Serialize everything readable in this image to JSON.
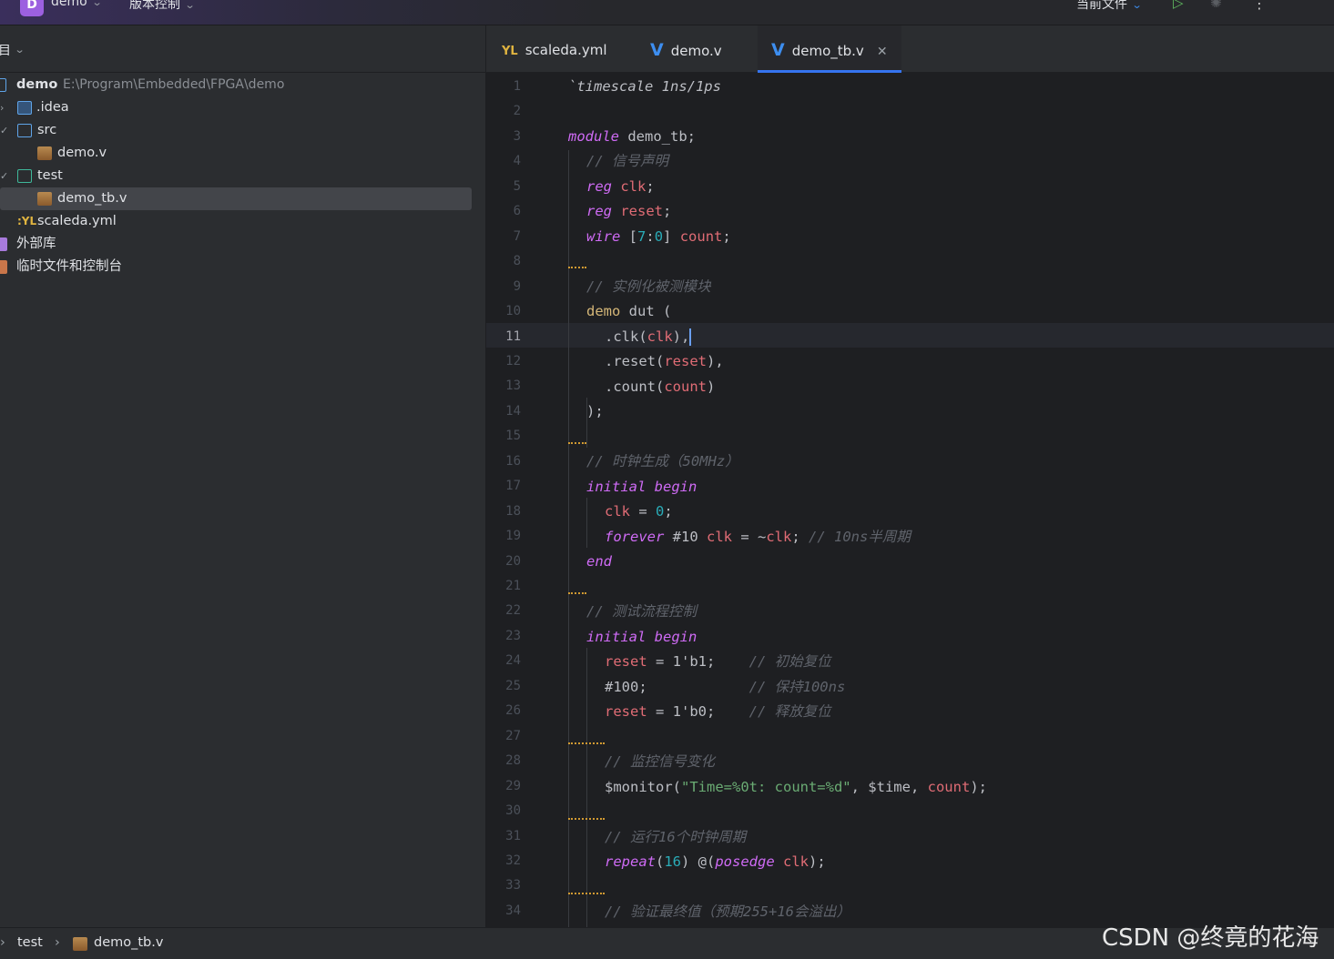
{
  "titlebar": {
    "project_badge": "D",
    "project_name": "demo",
    "vcs_label": "版本控制",
    "run_config": "当前文件",
    "icons": [
      "chevron-down-icon",
      "run-icon",
      "debug-icon",
      "more-icon"
    ]
  },
  "sidebar": {
    "title": "目",
    "root_name": "demo",
    "root_path": "E:\\Program\\Embedded\\FPGA\\demo",
    "items": [
      {
        "label": ".idea"
      },
      {
        "label": "src"
      },
      {
        "label": "demo.v"
      },
      {
        "label": "test"
      },
      {
        "label": "demo_tb.v"
      },
      {
        "label": "scaleda.yml"
      },
      {
        "label": "外部库"
      },
      {
        "label": "临时文件和控制台"
      }
    ]
  },
  "tabs": [
    {
      "label": "scaleda.yml",
      "icon": "yaml-file-icon",
      "active": false
    },
    {
      "label": "demo.v",
      "icon": "verilog-v-icon",
      "active": false
    },
    {
      "label": "demo_tb.v",
      "icon": "verilog-v-icon",
      "active": true
    }
  ],
  "editor": {
    "current_line": "11",
    "line_numbers": [
      "1",
      "2",
      "3",
      "4",
      "5",
      "6",
      "7",
      "8",
      "9",
      "10",
      "11",
      "12",
      "13",
      "14",
      "15",
      "16",
      "17",
      "18",
      "19",
      "20",
      "21",
      "22",
      "23",
      "24",
      "25",
      "26",
      "27",
      "28",
      "29",
      "30",
      "31",
      "32",
      "33",
      "34"
    ],
    "code": {
      "l1_dir": "`timescale 1ns/1ps",
      "l3_kw": "module",
      "l3_name": " demo_tb;",
      "l4_cm": "// 信号声明",
      "l5_kw": "reg",
      "l5_id": " clk",
      "l5_end": ";",
      "l6_kw": "reg",
      "l6_id": " reset",
      "l6_end": ";",
      "l7_kw": "wire",
      "l7_mid": " [",
      "l7_n1": "7",
      "l7_c": ":",
      "l7_n2": "0",
      "l7_mid2": "] ",
      "l7_id": "count",
      "l7_end": ";",
      "l9_cm": "// 实例化被测模块",
      "l10_mod": "demo",
      "l10_rest": " dut (",
      "l11_a": ".clk(",
      "l11_id": "clk",
      "l11_b": "),",
      "l12_a": ".reset(",
      "l12_id": "reset",
      "l12_b": "),",
      "l13_a": ".count(",
      "l13_id": "count",
      "l13_b": ")",
      "l14": ");",
      "l16_cm": "// 时钟生成（50MHz）",
      "l17_kw": "initial begin",
      "l18_id": "clk",
      "l18_mid": " = ",
      "l18_num": "0",
      "l18_end": ";",
      "l19_kw": "forever",
      "l19_mid": " #10 ",
      "l19_id": "clk",
      "l19_mid2": " = ~",
      "l19_id2": "clk",
      "l19_end": "; ",
      "l19_cm": "// 10ns半周期",
      "l20_kw": "end",
      "l22_cm": "// 测试流程控制",
      "l23_kw": "initial begin",
      "l24_id": "reset",
      "l24_mid": " = 1'b1;    ",
      "l24_cm": "// 初始复位",
      "l25_txt": "#100;            ",
      "l25_cm": "// 保持100ns",
      "l26_id": "reset",
      "l26_mid": " = 1'b0;    ",
      "l26_cm": "// 释放复位",
      "l28_cm": "// 监控信号变化",
      "l29_a": "$monitor(",
      "l29_str": "\"Time=%0t: count=%d\"",
      "l29_b": ", $time, ",
      "l29_id": "count",
      "l29_c": ");",
      "l31_cm": "// 运行16个时钟周期",
      "l32_kw": "repeat",
      "l32_a": "(",
      "l32_num": "16",
      "l32_b": ") @(",
      "l32_kw2": "posedge",
      "l32_id": " clk",
      "l32_c": ");",
      "l34_cm": "// 验证最终值（预期255+16会溢出）"
    }
  },
  "statusbar": {
    "crumb1": "test",
    "crumb2": "demo_tb.v"
  },
  "watermark": "CSDN @终竟的花海"
}
